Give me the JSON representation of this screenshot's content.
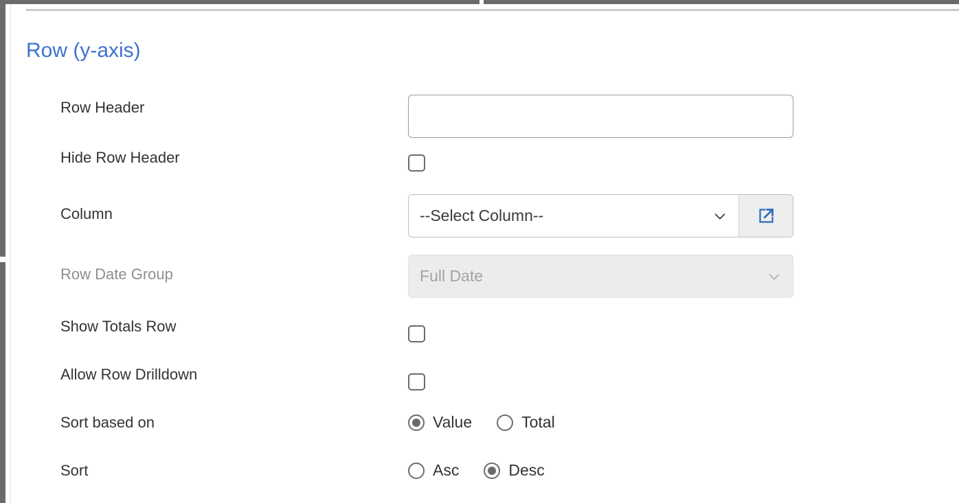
{
  "section": {
    "title": "Row (y-axis)",
    "title_color": "#3f72d0"
  },
  "fields": {
    "row_header": {
      "label": "Row Header",
      "value": "",
      "placeholder": ""
    },
    "hide_row_header": {
      "label": "Hide Row Header",
      "checked": false
    },
    "column": {
      "label": "Column",
      "value": "--Select Column--",
      "chevron_icon": "chevron-down-icon",
      "open_button_icon": "external-link-icon"
    },
    "row_date_group": {
      "label": "Row Date Group",
      "value": "Full Date",
      "disabled": true,
      "chevron_icon": "chevron-down-icon"
    },
    "show_totals_row": {
      "label": "Show Totals Row",
      "checked": false
    },
    "allow_row_drilldown": {
      "label": "Allow Row Drilldown",
      "checked": false
    },
    "sort_based_on": {
      "label": "Sort based on",
      "options": [
        {
          "label": "Value",
          "selected": true
        },
        {
          "label": "Total",
          "selected": false
        }
      ]
    },
    "sort": {
      "label": "Sort",
      "options": [
        {
          "label": "Asc",
          "selected": false
        },
        {
          "label": "Desc",
          "selected": true
        }
      ]
    }
  }
}
